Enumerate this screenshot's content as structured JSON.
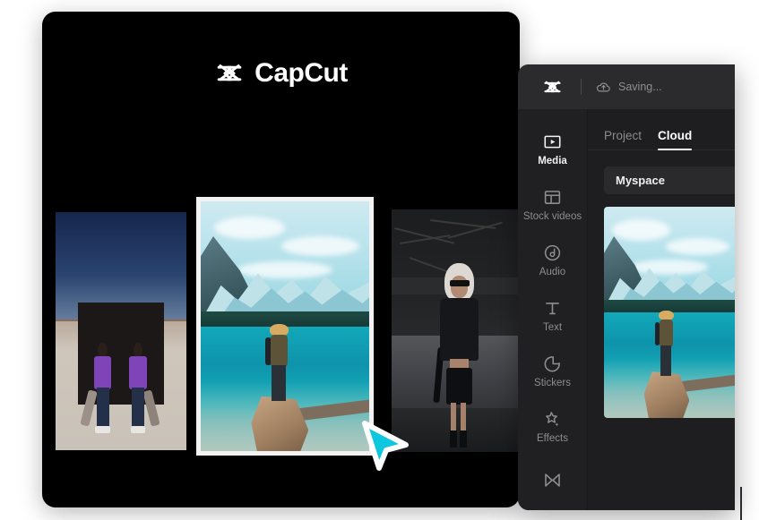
{
  "promo": {
    "brand_name": "CapCut",
    "brand_icon": "capcut-hourglass-icon",
    "photos": [
      {
        "id": "photo-skaters",
        "alt": "Two skateboarders in purple shirts",
        "selected": false
      },
      {
        "id": "photo-mountain-lake",
        "alt": "Hiker on rock overlooking turquoise mountain lake",
        "selected": true
      },
      {
        "id": "photo-fashion-woman",
        "alt": "Woman in black leather outfit on city street",
        "selected": false
      }
    ],
    "cursor_color": "#0ec6dd"
  },
  "editor": {
    "header": {
      "logo_icon": "capcut-hourglass-icon",
      "status_icon": "cloud-upload-icon",
      "status_text": "Saving..."
    },
    "rail": {
      "items": [
        {
          "label": "Media",
          "icon": "media-icon",
          "active": true
        },
        {
          "label": "Stock videos",
          "icon": "stock-videos-icon",
          "active": false
        },
        {
          "label": "Audio",
          "icon": "audio-icon",
          "active": false
        },
        {
          "label": "Text",
          "icon": "text-icon",
          "active": false
        },
        {
          "label": "Stickers",
          "icon": "stickers-icon",
          "active": false
        },
        {
          "label": "Effects",
          "icon": "effects-icon",
          "active": false
        },
        {
          "label": "",
          "icon": "transitions-icon",
          "active": false
        }
      ]
    },
    "tabs": [
      {
        "label": "Project",
        "active": false
      },
      {
        "label": "Cloud",
        "active": true
      }
    ],
    "library": {
      "folder_label": "Myspace",
      "thumbnail": {
        "id": "thumb-mountain-lake",
        "alt": "Hiker on rock overlooking turquoise mountain lake"
      }
    }
  },
  "colors": {
    "accent_cursor": "#0ec6dd",
    "panel_bg": "#1e1e20",
    "header_bg": "#2b2b2d",
    "rail_bg": "#201f22",
    "row_bg": "#2a2a2c",
    "text_muted": "#8a8a8d",
    "text_active": "#ffffff",
    "page_bg": "#ffffff",
    "card_bg": "#000000"
  }
}
